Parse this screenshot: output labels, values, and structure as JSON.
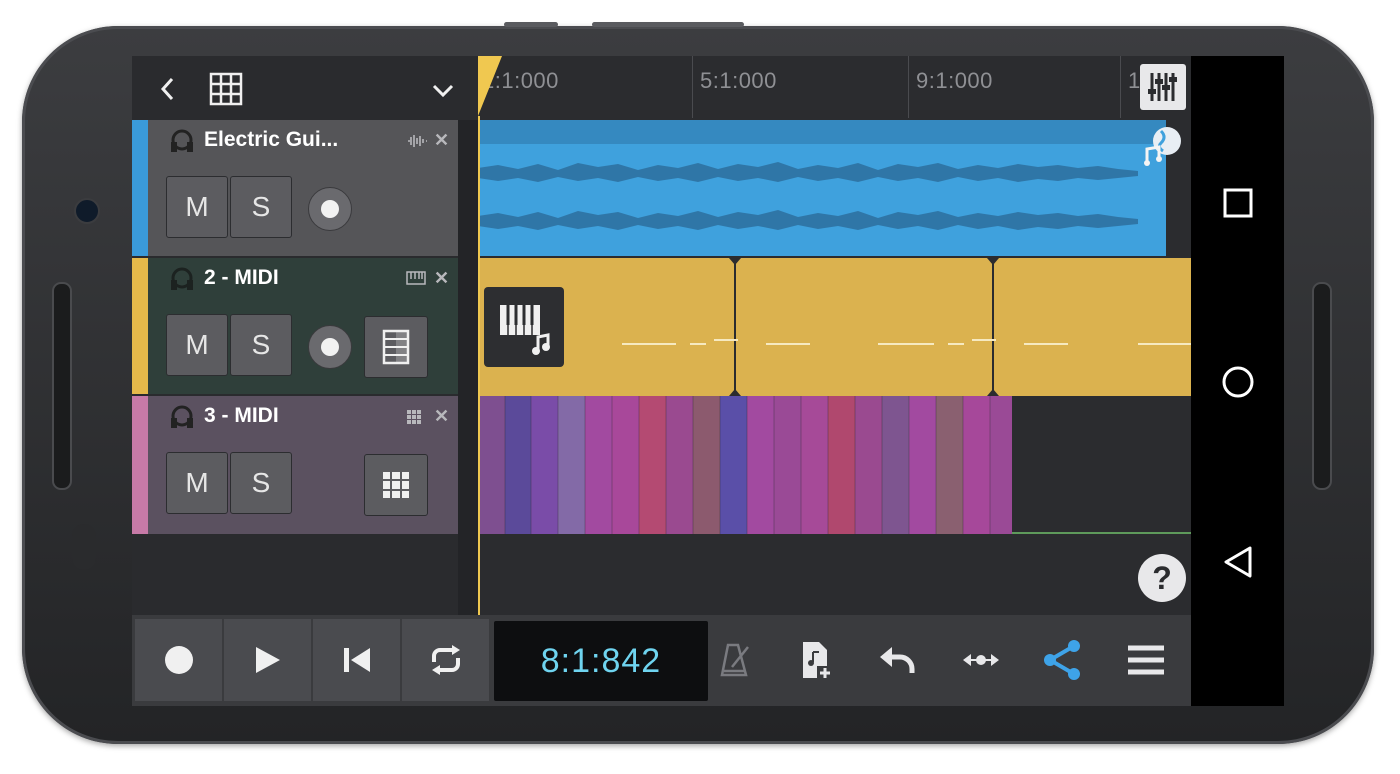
{
  "ruler": {
    "marks": [
      "1:1:000",
      "5:1:000",
      "9:1:000",
      "13"
    ]
  },
  "tracks": [
    {
      "name": "Electric Gui...",
      "mute_label": "M",
      "solo_label": "S",
      "color": "#3a9ad9",
      "bg": "#555558",
      "lane_color": "#3a9ad9"
    },
    {
      "name": "2 - MIDI",
      "mute_label": "M",
      "solo_label": "S",
      "color": "#e5b94a",
      "bg": "#2f3f3a",
      "lane_color": "#d9b04f"
    },
    {
      "name": "3 - MIDI",
      "mute_label": "M",
      "solo_label": "S",
      "color": "#c77aa7",
      "bg": "#5b5160",
      "lane_color": "#7a4c7a"
    }
  ],
  "transport": {
    "time": "8:1:842"
  },
  "colors": {
    "accent": "#3ea3e8",
    "counter_text": "#6fd4f0",
    "playhead": "#f0c850"
  },
  "icons": [
    "back-icon",
    "grid-icon",
    "chevron-down-icon",
    "mixer-icon",
    "help-icon",
    "record-icon",
    "play-icon",
    "skip-start-icon",
    "loop-icon",
    "metronome-icon",
    "new-file-icon",
    "undo-icon",
    "zoom-fit-icon",
    "share-icon",
    "menu-icon"
  ]
}
